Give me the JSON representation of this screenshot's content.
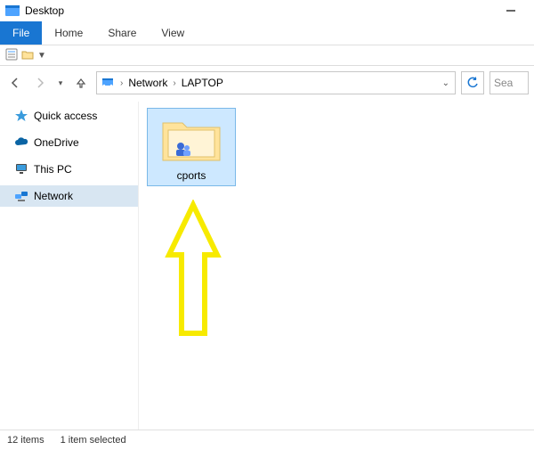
{
  "window": {
    "title": "Desktop"
  },
  "ribbon": {
    "file": "File",
    "tabs": [
      "Home",
      "Share",
      "View"
    ]
  },
  "breadcrumb": {
    "items": [
      "Network",
      "LAPTOP"
    ]
  },
  "search": {
    "placeholder": "Sea"
  },
  "nav": {
    "items": [
      {
        "label": "Quick access"
      },
      {
        "label": "OneDrive"
      },
      {
        "label": "This PC"
      },
      {
        "label": "Network",
        "selected": true
      }
    ]
  },
  "content": {
    "items": [
      {
        "label": "cports",
        "type": "shared-folder",
        "selected": true
      }
    ]
  },
  "status": {
    "count_text": "12 items",
    "selection_text": "1 item selected"
  },
  "annotation": {
    "type": "arrow-up",
    "color": "#f7ea00"
  }
}
